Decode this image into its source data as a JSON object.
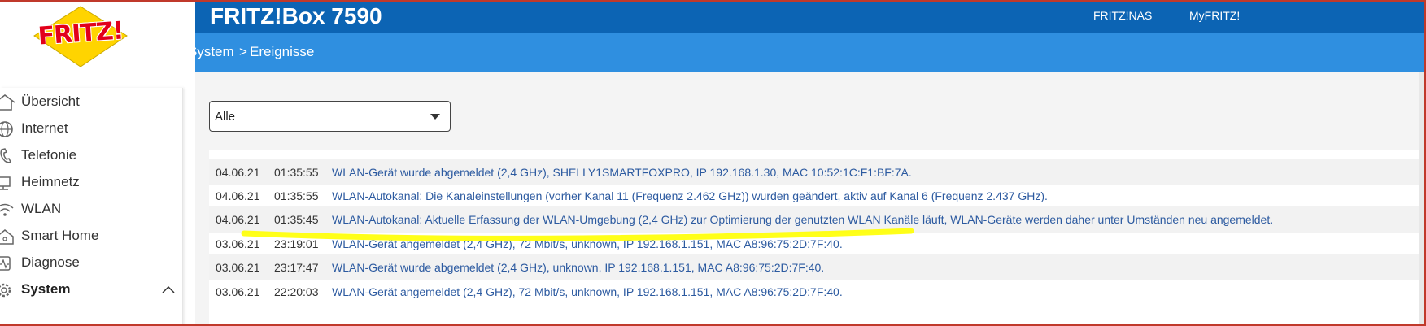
{
  "header": {
    "logo_text": "FRITZ!",
    "title": "FRITZ!Box 7590",
    "links": [
      "FRITZ!NAS",
      "MyFRITZ!"
    ]
  },
  "breadcrumb": {
    "section": "System",
    "separator": ">",
    "page": "Ereignisse"
  },
  "sidebar": {
    "items": [
      {
        "label": "Übersicht",
        "icon": "home-icon"
      },
      {
        "label": "Internet",
        "icon": "globe-icon"
      },
      {
        "label": "Telefonie",
        "icon": "phone-icon"
      },
      {
        "label": "Heimnetz",
        "icon": "network-icon"
      },
      {
        "label": "WLAN",
        "icon": "wifi-icon"
      },
      {
        "label": "Smart Home",
        "icon": "smart-home-icon"
      },
      {
        "label": "Diagnose",
        "icon": "diagnose-icon"
      },
      {
        "label": "System",
        "icon": "system-icon",
        "active": true,
        "expanded": true
      }
    ]
  },
  "filter": {
    "selected": "Alle"
  },
  "events": [
    {
      "date": "04.06.21",
      "time": "01:35:55",
      "message": "WLAN-Gerät wurde abgemeldet (2,4 GHz), SHELLY1SMARTFOXPRO, IP 192.168.1.30, MAC 10:52:1C:F1:BF:7A."
    },
    {
      "date": "04.06.21",
      "time": "01:35:55",
      "message": "WLAN-Autokanal: Die Kanaleinstellungen (vorher Kanal 11 (Frequenz 2.462 GHz)) wurden geändert, aktiv auf Kanal 6 (Frequenz 2.437 GHz)."
    },
    {
      "date": "04.06.21",
      "time": "01:35:45",
      "message": "WLAN-Autokanal: Aktuelle Erfassung der WLAN-Umgebung (2,4 GHz) zur Optimierung der genutzten WLAN Kanäle läuft, WLAN-Geräte werden daher unter Umständen neu angemeldet.",
      "highlighted": true
    },
    {
      "date": "03.06.21",
      "time": "23:19:01",
      "message": "WLAN-Gerät angemeldet (2,4 GHz), 72 Mbit/s, unknown, IP 192.168.1.151, MAC A8:96:75:2D:7F:40."
    },
    {
      "date": "03.06.21",
      "time": "23:17:47",
      "message": "WLAN-Gerät wurde abgemeldet (2,4 GHz), unknown, IP 192.168.1.151, MAC A8:96:75:2D:7F:40."
    },
    {
      "date": "03.06.21",
      "time": "22:20:03",
      "message": "WLAN-Gerät angemeldet (2,4 GHz), 72 Mbit/s, unknown, IP 192.168.1.151, MAC A8:96:75:2D:7F:40."
    }
  ],
  "colors": {
    "header_blue": "#0c64b4",
    "breadcrumb_blue": "#2f8fe0",
    "link_blue": "#2c5aa0",
    "highlight_yellow": "#ffff00",
    "logo_red": "#e2001a",
    "logo_yellow": "#ffd400"
  }
}
